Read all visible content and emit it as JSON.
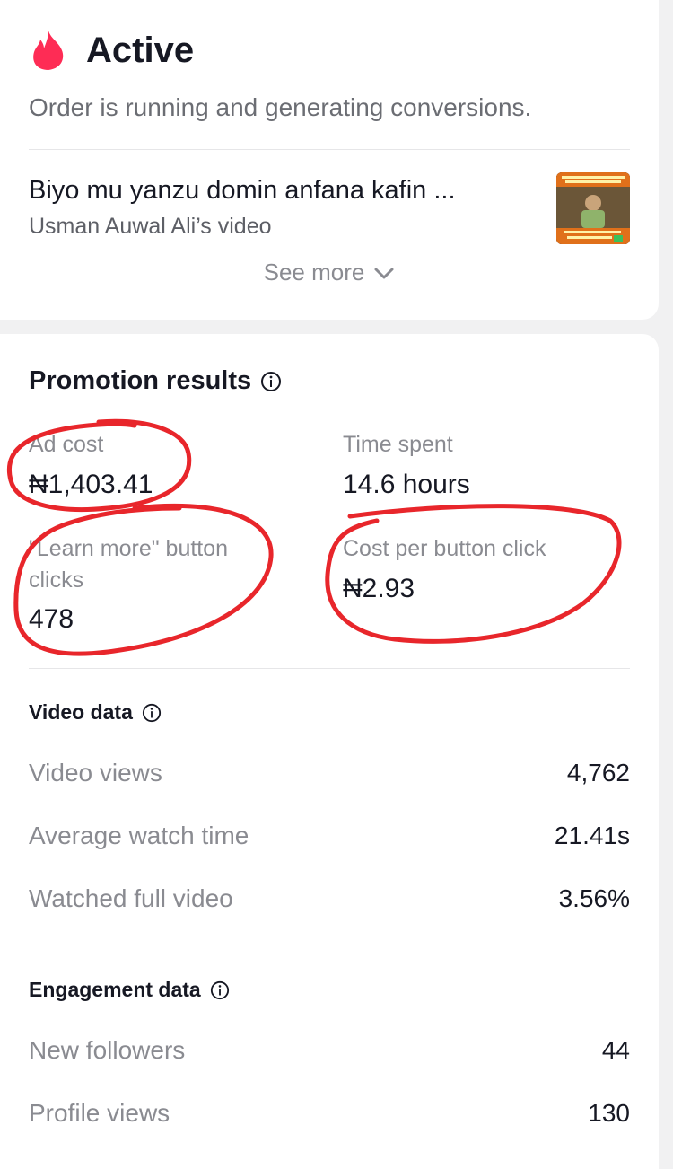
{
  "status": {
    "icon": "flame-icon",
    "title": "Active",
    "description": "Order is running and generating conversions."
  },
  "video": {
    "title": "Biyo mu yanzu domin anfana kafin ...",
    "subtitle": "Usman Auwal Ali’s video",
    "see_more": "See more"
  },
  "promotion_results": {
    "title": "Promotion results",
    "metrics": [
      {
        "label": "Ad cost",
        "value": "₦1,403.41"
      },
      {
        "label": "Time spent",
        "value": "14.6 hours"
      },
      {
        "label": "\"Learn more\" button clicks",
        "label_line1": "\"Learn more\" button",
        "label_line2": "clicks",
        "value": "478"
      },
      {
        "label": "Cost per button click",
        "value": "₦2.93"
      }
    ]
  },
  "video_data": {
    "title": "Video data",
    "rows": [
      {
        "label": "Video views",
        "value": "4,762"
      },
      {
        "label": "Average watch time",
        "value": "21.41s"
      },
      {
        "label": "Watched full video",
        "value": "3.56%"
      }
    ]
  },
  "engagement_data": {
    "title": "Engagement data",
    "rows": [
      {
        "label": "New followers",
        "value": "44"
      },
      {
        "label": "Profile views",
        "value": "130"
      }
    ]
  },
  "colors": {
    "flame": "#fe2c55",
    "annotation": "#e8262b",
    "background": "#f1f1f2"
  }
}
